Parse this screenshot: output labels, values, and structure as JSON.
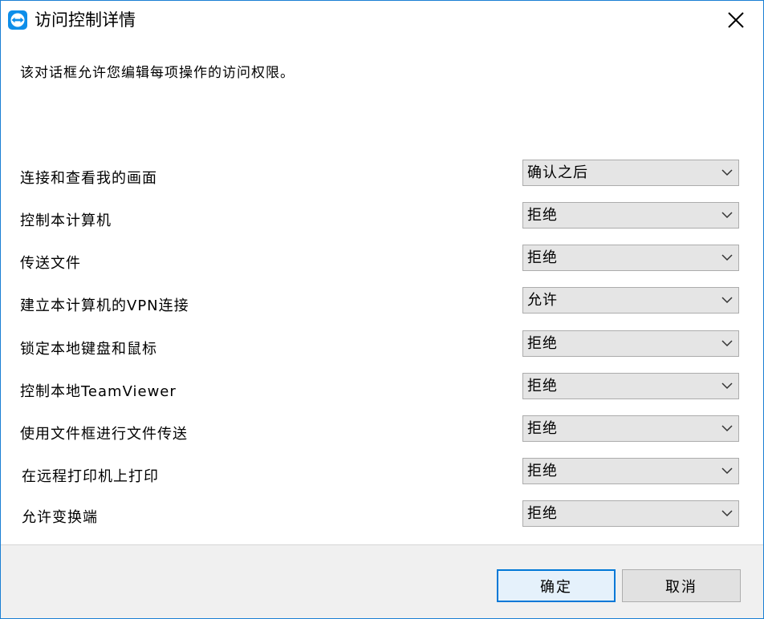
{
  "window": {
    "title": "访问控制详情",
    "description": "该对话框允许您编辑每项操作的访问权限。"
  },
  "colors": {
    "accent": "#0078d7",
    "border": "#1a7fd4",
    "select_bg": "#e5e5e5",
    "footer_bg": "#f0f0f0"
  },
  "icons": {
    "app": "teamviewer-logo-icon",
    "close": "close-icon",
    "dropdown": "chevron-down-icon"
  },
  "permissions": [
    {
      "label": "连接和查看我的画面",
      "value": "确认之后"
    },
    {
      "label": "控制本计算机",
      "value": "拒绝"
    },
    {
      "label": "传送文件",
      "value": "拒绝"
    },
    {
      "label": "建立本计算机的VPN连接",
      "value": "允许"
    },
    {
      "label": "锁定本地键盘和鼠标",
      "value": "拒绝"
    },
    {
      "label": "控制本地TeamViewer",
      "value": "拒绝"
    },
    {
      "label": "使用文件框进行文件传送",
      "value": "拒绝"
    },
    {
      "label": "在远程打印机上打印",
      "value": "拒绝"
    },
    {
      "label": "允许变换端",
      "value": "拒绝"
    }
  ],
  "footer": {
    "ok_label": "确定",
    "cancel_label": "取消"
  }
}
